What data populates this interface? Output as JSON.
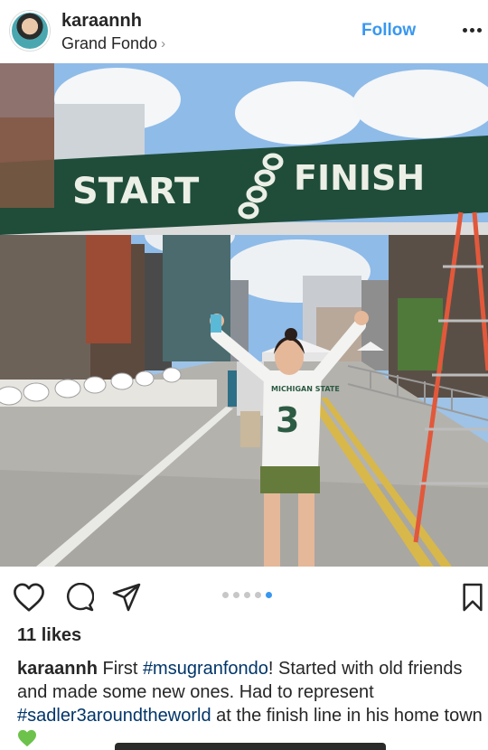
{
  "header": {
    "username": "karaannh",
    "location": "Grand Fondo",
    "location_chevron": "›",
    "follow_label": "Follow",
    "more_icon": "more-horizontal-icon"
  },
  "photo": {
    "banner_left": "START",
    "banner_right": "FINISH",
    "shirt_text": "MICHIGAN STATE",
    "shirt_number": "3"
  },
  "carousel": {
    "count": 5,
    "active_index": 4
  },
  "actions": {
    "like_icon": "heart-icon",
    "comment_icon": "comment-icon",
    "share_icon": "direct-share-icon",
    "save_icon": "bookmark-icon"
  },
  "likes": "11 likes",
  "caption": {
    "username": "karaannh",
    "text1": " First ",
    "tag1": "#msugranfondo",
    "text2": "! Started with old friends and made  some new ones. Had to represent ",
    "tag2": "#sadler3aroundtheworld",
    "text3": " at the finish line in his home town",
    "emoji": "green-heart-emoji"
  },
  "colors": {
    "follow": "#3897f0",
    "hashtag": "#003569",
    "banner": "#1f4d3a",
    "active_dot": "#3897f0"
  }
}
